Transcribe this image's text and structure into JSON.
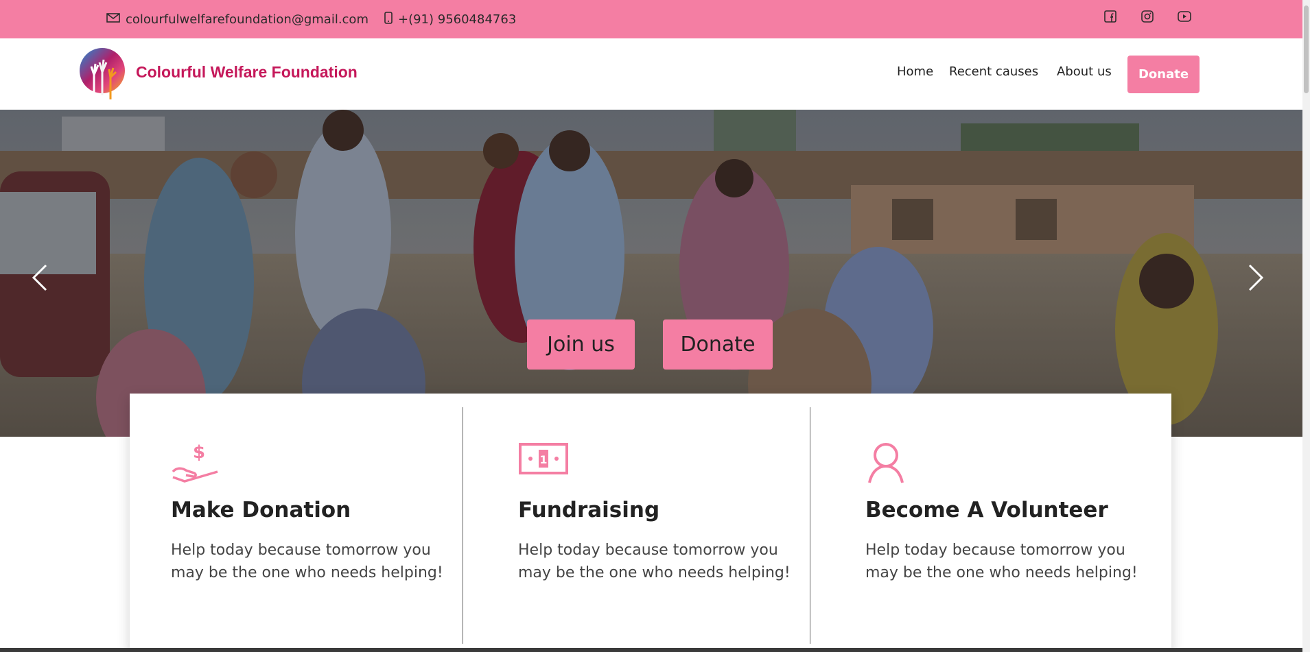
{
  "topbar": {
    "email": "colourfulwelfarefoundation@gmail.com",
    "phone": "+(91) 9560484763",
    "email_icon": "mail-icon",
    "phone_icon": "mobile-phone-icon",
    "social_icons": [
      "facebook-icon",
      "instagram-icon",
      "youtube-icon"
    ],
    "bg_color": "#f47ea3"
  },
  "nav": {
    "brand": "Colourful Welfare Foundation",
    "links": [
      "Home",
      "Recent causes",
      "About us"
    ],
    "donate_label": "Donate"
  },
  "hero": {
    "join_label": "Join us",
    "donate_label": "Donate",
    "prev_icon": "chevron-left-icon",
    "next_icon": "chevron-right-icon"
  },
  "cards": [
    {
      "icon": "hand-dollar-icon",
      "title": "Make Donation",
      "text": "Help today because tomorrow you may be the one who needs helping!"
    },
    {
      "icon": "banknote-icon",
      "title": "Fundraising",
      "text": "Help today because tomorrow you may be the one who needs helping!"
    },
    {
      "icon": "user-icon",
      "title": "Become A Volunteer",
      "text": "Help today because tomorrow you may be the one who needs helping!"
    }
  ],
  "colors": {
    "accent": "#f47ea3",
    "brand": "#c5185a"
  }
}
